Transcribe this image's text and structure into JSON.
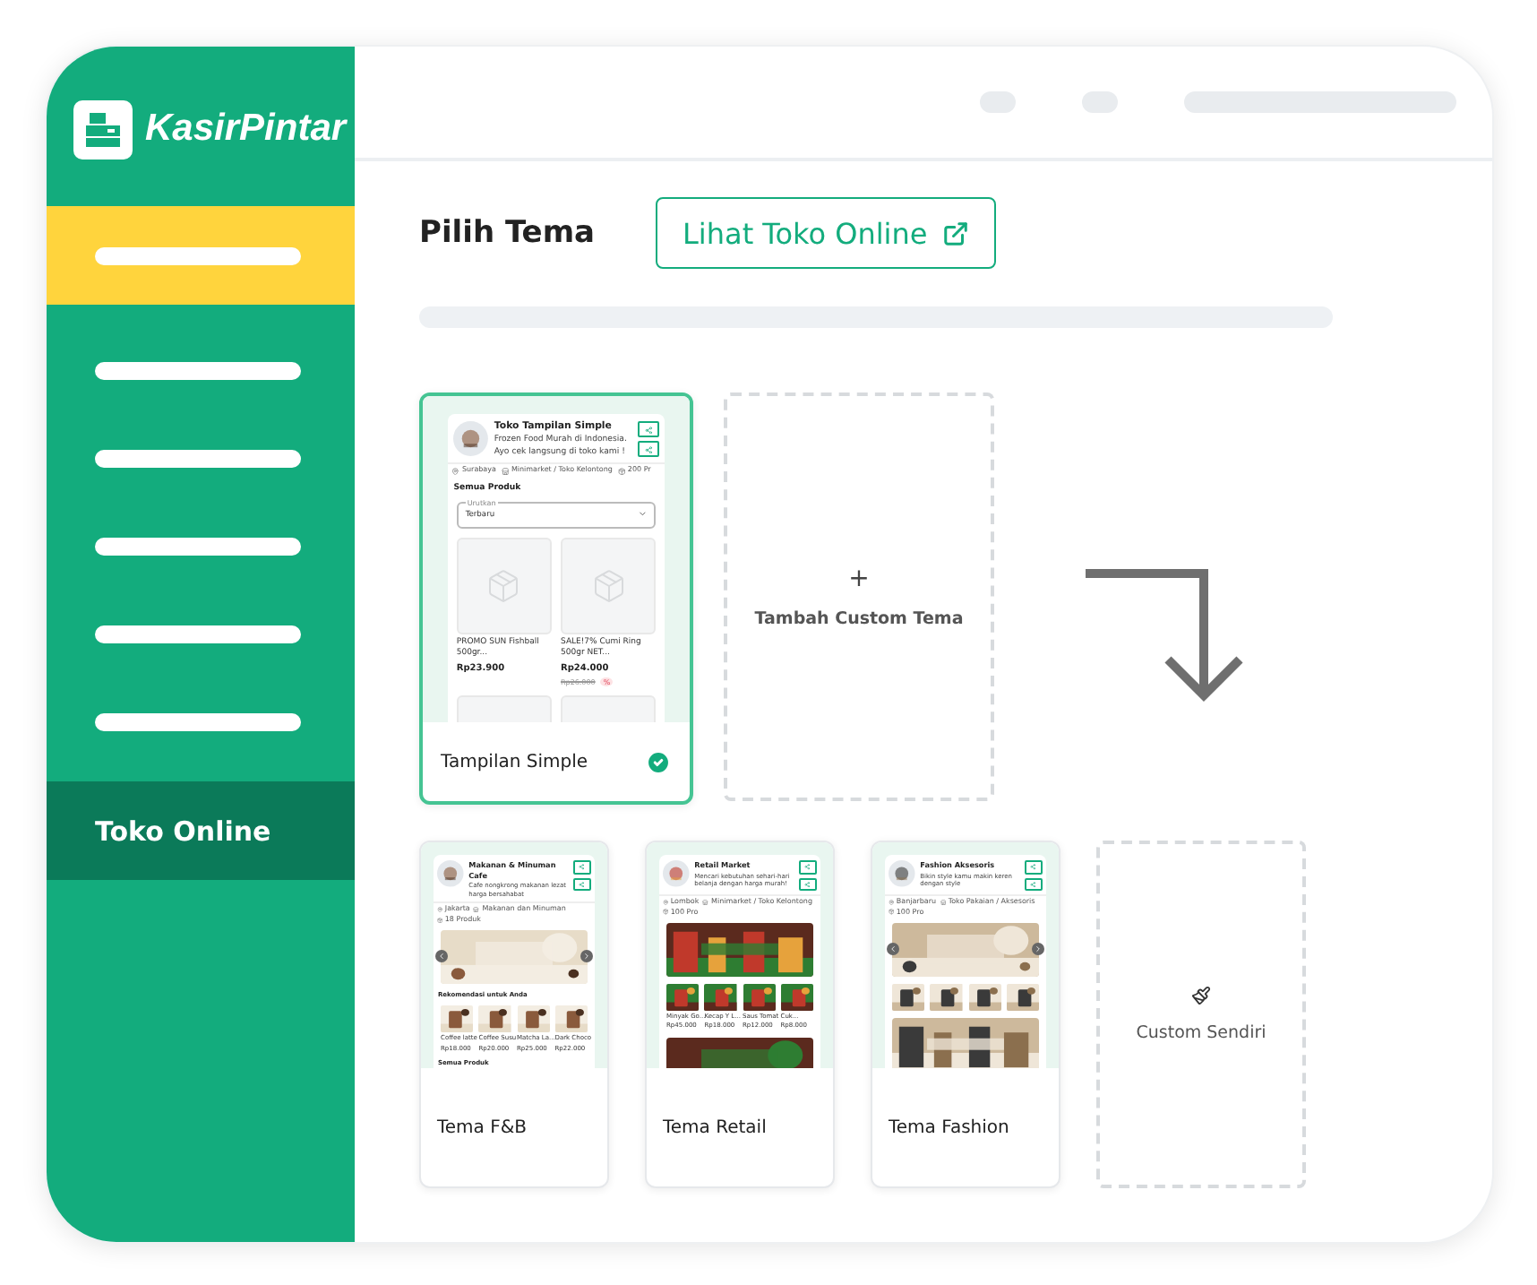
{
  "sidebar": {
    "logo": "KasirPintar",
    "items": [
      {
        "kind": "bar",
        "highlighted": true,
        "selected": false
      },
      {
        "kind": "bar",
        "highlighted": false,
        "selected": false
      },
      {
        "kind": "bar",
        "highlighted": false,
        "selected": false
      },
      {
        "kind": "bar",
        "highlighted": false,
        "selected": false
      },
      {
        "kind": "bar",
        "highlighted": false,
        "selected": false
      },
      {
        "kind": "bar",
        "highlighted": false,
        "selected": false
      },
      {
        "kind": "label",
        "label": "Toko Online",
        "highlighted": false,
        "selected": true
      }
    ]
  },
  "header": {
    "title": "Pilih Tema",
    "button": "Lihat Toko Online"
  },
  "featured": [
    {
      "name": "Tampilan Simple",
      "selected": true,
      "preview": {
        "store": "Toko Tampilan Simple",
        "description": "Frozen Food Murah di Indonesia. Ayo cek langsung di toko kami !",
        "info": [
          "Surabaya",
          "Minimarket / Toko Kelontong",
          "200 Pr"
        ],
        "sections": [
          {
            "kind": "heading",
            "text": "Semua Produk"
          },
          {
            "kind": "select",
            "label": "Urutkan",
            "value": "Terbaru"
          },
          {
            "kind": "grid",
            "items": [
              {
                "name": "PROMO SUN Fishball 500gr...",
                "price": "Rp23.900"
              },
              {
                "name": "SALE!7% Cumi Ring 500gr NET...",
                "price": "Rp24.000",
                "old_price": "Rp26.000",
                "badge": "%"
              }
            ]
          }
        ]
      }
    }
  ],
  "add_card": {
    "icon": "+",
    "label": "Tambah Custom Tema"
  },
  "templates": [
    {
      "name": "Tema F&B",
      "preview": {
        "store": "Makanan & Minuman Cafe",
        "description": "Cafe nongkrong makanan lezat harga bersahabat",
        "info": [
          "Jakarta",
          "Makanan dan Minuman",
          "18 Produk"
        ],
        "sections": [
          {
            "kind": "banner",
            "arrows": true
          },
          {
            "kind": "heading",
            "text": "Rekomendasi untuk Anda"
          },
          {
            "kind": "products",
            "items": [
              {
                "name": "Coffee latte",
                "price": "Rp18.000"
              },
              {
                "name": "Coffee Susu",
                "price": "Rp20.000"
              },
              {
                "name": "Matcha La...",
                "price": "Rp25.000"
              },
              {
                "name": "Dark Choco",
                "price": "Rp22.000"
              }
            ]
          },
          {
            "kind": "heading",
            "text": "Semua Produk"
          }
        ]
      }
    },
    {
      "name": "Tema Retail",
      "preview": {
        "store": "Retail Market",
        "description": "Mencari kebutuhan sehari-hari belanja dengan harga murah!",
        "info": [
          "Lombok",
          "Minimarket / Toko Kelontong",
          "100 Pro"
        ],
        "sections": [
          {
            "kind": "banner"
          },
          {
            "kind": "products",
            "items": [
              {
                "name": "Minyak Go...",
                "price": "Rp45.000"
              },
              {
                "name": "Kecap Y L...",
                "price": "Rp18.000"
              },
              {
                "name": "Saus Tomat",
                "price": "Rp12.000"
              },
              {
                "name": "Cuk...",
                "price": "Rp8.000"
              }
            ]
          },
          {
            "kind": "banner"
          }
        ]
      }
    },
    {
      "name": "Tema Fashion",
      "preview": {
        "store": "Fashion Aksesoris",
        "description": "Bikin style kamu makin keren dengan style",
        "info": [
          "Banjarbaru",
          "Toko Pakaian / Aksesoris",
          "100 Pro"
        ],
        "sections": [
          {
            "kind": "banner",
            "arrows": true
          },
          {
            "kind": "thumbnails"
          },
          {
            "kind": "banner"
          }
        ]
      }
    }
  ],
  "custom_card": {
    "label": "Custom Sendiri"
  }
}
